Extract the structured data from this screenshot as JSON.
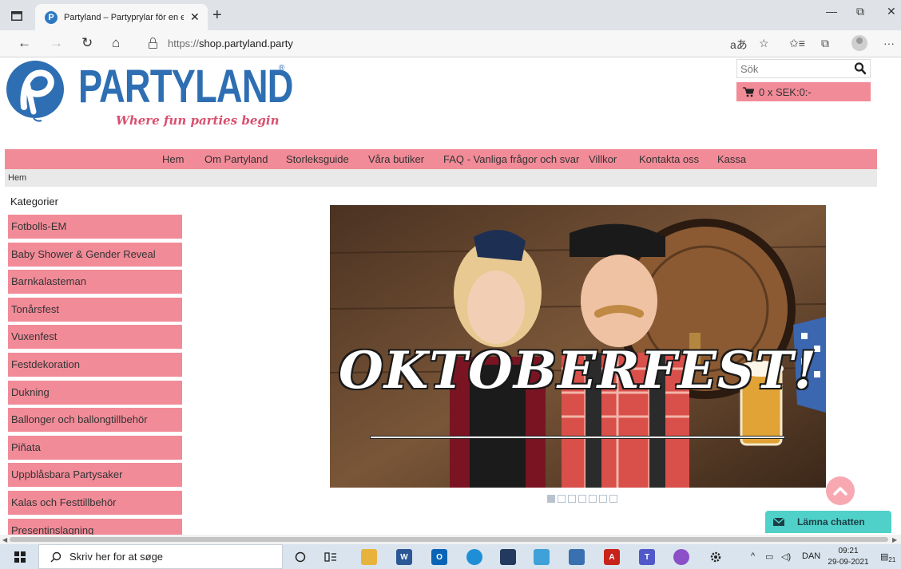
{
  "browser": {
    "tab_title": "Partyland – Partyprylar för en extr",
    "tab_close": "✕",
    "new_tab": "+",
    "url_scheme": "https://",
    "url_host": "shop.partyland.party",
    "window": {
      "minimize": "—",
      "restore": "⧉",
      "close": "✕"
    },
    "nav": {
      "back": "←",
      "forward": "→",
      "refresh": "↻",
      "home": "⌂"
    },
    "tools": {
      "read_aloud": "aあ",
      "favorite": "☆",
      "favorites": "✩≡",
      "collections": "⧉",
      "more": "···"
    }
  },
  "site": {
    "logo_word": "PARTYLAND",
    "logo_reg": "®",
    "tagline": "Where fun parties begin",
    "search_placeholder": "Sök",
    "cart_text": "0 x SEK:0:-",
    "nav": [
      "Hem",
      "Om Partyland",
      "Storleksguide",
      "Våra butiker",
      "FAQ - Vanliga frågor och svar",
      "Villkor",
      "Kontakta oss",
      "Kassa"
    ],
    "breadcrumb": "Hem",
    "categories_title": "Kategorier",
    "categories": [
      "Fotbolls-EM",
      "Baby Shower & Gender Reveal",
      "Barnkalasteman",
      "Tonårsfest",
      "Vuxenfest",
      "Festdekoration",
      "Dukning",
      "Ballonger och ballongtillbehör",
      "Piñata",
      "Uppblåsbara Partysaker",
      "Kalas och Festtillbehör",
      "Presentinslagning"
    ],
    "banner_text": "OKTOBERFEST!",
    "slider_count": 7,
    "slider_active": 1,
    "chat_label": "Lämna chatten"
  },
  "taskbar": {
    "search_placeholder": "Skriv her for at søge",
    "language": "DAN",
    "time": "09:21",
    "date": "29-09-2021",
    "notifications": "21"
  },
  "colors": {
    "brand_blue": "#2e6eb3",
    "brand_pink": "#f28b98",
    "tagline_pink": "#d8506f",
    "chat_teal": "#4fd1c9"
  }
}
